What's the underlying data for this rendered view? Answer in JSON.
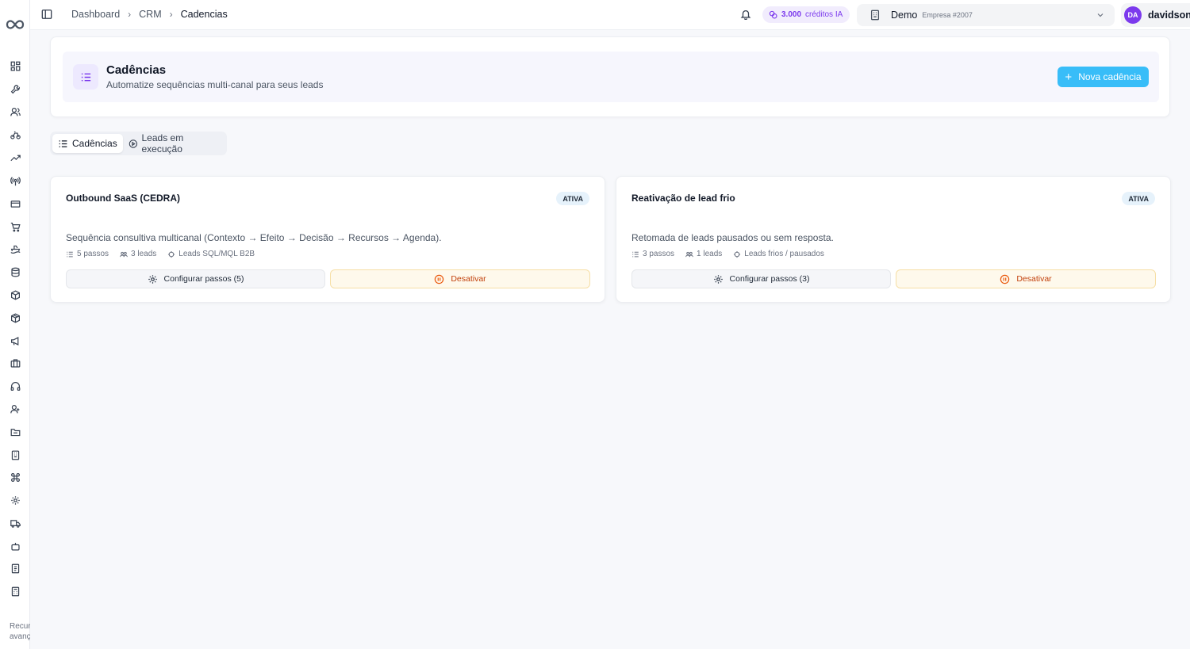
{
  "app": {
    "logo_icon": "infinity-logo-icon",
    "sidebar_footer": "Recursos avançados"
  },
  "sidebar": {
    "icons": [
      "dashboard-grid-icon",
      "wrench-icon",
      "users-icon",
      "bike-icon",
      "trending-up-icon",
      "radio-signal-icon",
      "credit-card-icon",
      "cart-icon",
      "ship-icon",
      "database-icon",
      "package-icon",
      "box-icon",
      "megaphone-icon",
      "briefcase-icon",
      "headphones-icon",
      "contacts-icon",
      "folder-icon",
      "building-icon",
      "command-icon",
      "gear-icon",
      "truck-icon",
      "robot-icon",
      "receipt-icon",
      "calculator-icon"
    ]
  },
  "topbar": {
    "breadcrumb": [
      "Dashboard",
      "CRM",
      "Cadencias"
    ],
    "credits_value": "3.000",
    "credits_unit": "créditos IA",
    "company_name": "Demo",
    "company_sub": "Empresa #2007",
    "user_initials": "DA",
    "user_name": "davidson"
  },
  "header": {
    "title": "Cadências",
    "subtitle": "Automatize sequências multi-canal para seus leads",
    "new_button": "Nova cadência"
  },
  "tabs": [
    {
      "label": "Cadências",
      "active": true
    },
    {
      "label": "Leads em execução",
      "active": false
    }
  ],
  "cards": [
    {
      "title": "Outbound SaaS (CEDRA)",
      "status": "ATIVA",
      "description": "Sequência consultiva multicanal (Contexto → Efeito → Decisão → Recursos → Agenda).",
      "steps": "5 passos",
      "leads": "3 leads",
      "target": "Leads SQL/MQL B2B",
      "config_label": "Configurar passos (5)",
      "deactivate_label": "Desativar"
    },
    {
      "title": "Reativação de lead frio",
      "status": "ATIVA",
      "description": "Retomada de leads pausados ou sem resposta.",
      "steps": "3 passos",
      "leads": "1 leads",
      "target": "Leads frios / pausados",
      "config_label": "Configurar passos (3)",
      "deactivate_label": "Desativar"
    }
  ],
  "colors": {
    "accent_purple": "#7c3aed",
    "primary_button": "#38bdf8",
    "deactivate_text": "#c2410c"
  }
}
